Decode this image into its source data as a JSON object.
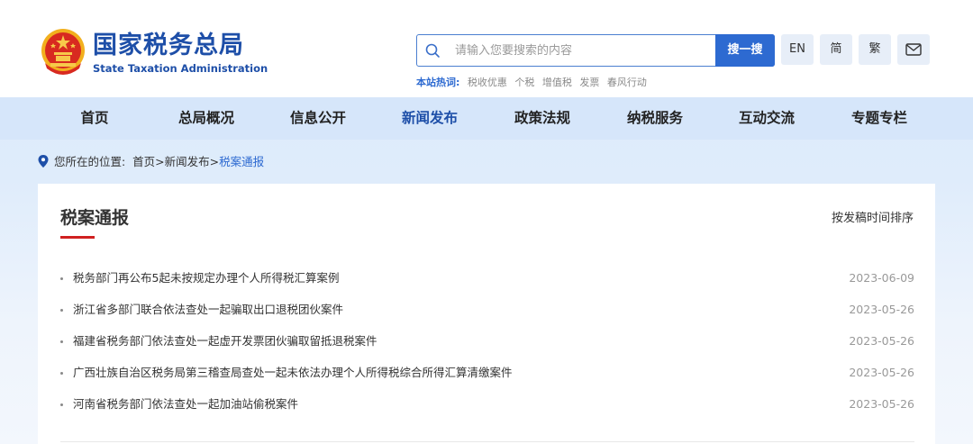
{
  "header": {
    "brand_cn": "国家税务总局",
    "brand_en": "State Taxation Administration",
    "logo_icon": "national-emblem-icon",
    "search": {
      "placeholder": "请输入您要搜索的内容",
      "button_label": "搜一搜"
    },
    "hot": {
      "label": "本站热词:",
      "items": [
        "税收优惠",
        "个税",
        "增值税",
        "发票",
        "春风行动"
      ]
    },
    "tools": {
      "en": "EN",
      "simplified": "简",
      "traditional": "繁",
      "mail_icon": "mail-icon"
    }
  },
  "nav": {
    "items": [
      "首页",
      "总局概况",
      "信息公开",
      "新闻发布",
      "政策法规",
      "纳税服务",
      "互动交流",
      "专题专栏"
    ],
    "active": "新闻发布"
  },
  "breadcrumb": {
    "prefix": "您所在的位置:",
    "path": "首页>新闻发布>",
    "current": "税案通报"
  },
  "section": {
    "title": "税案通报",
    "sort_label": "按发稿时间排序",
    "items": [
      {
        "title": "税务部门再公布5起未按规定办理个人所得税汇算案例",
        "date": "2023-06-09"
      },
      {
        "title": "浙江省多部门联合依法查处一起骗取出口退税团伙案件",
        "date": "2023-05-26"
      },
      {
        "title": "福建省税务部门依法查处一起虚开发票团伙骗取留抵退税案件",
        "date": "2023-05-26"
      },
      {
        "title": "广西壮族自治区税务局第三稽查局查处一起未依法办理个人所得税综合所得汇算清缴案件",
        "date": "2023-05-26"
      },
      {
        "title": "河南省税务部门依法查处一起加油站偷税案件",
        "date": "2023-05-26"
      }
    ]
  },
  "colors": {
    "brand_blue": "#1e4fa8",
    "accent_blue": "#2d6ad1",
    "underline_red": "#d02020",
    "nav_bg": "#d6e6fa"
  }
}
